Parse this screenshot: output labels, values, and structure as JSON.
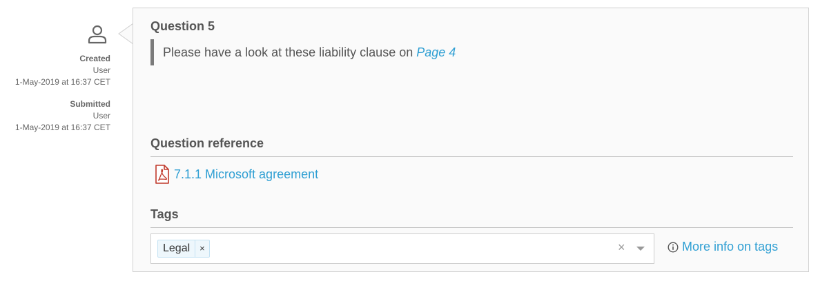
{
  "meta": {
    "created_label": "Created",
    "created_by": "User",
    "created_at": "1-May-2019 at 16:37 CET",
    "submitted_label": "Submitted",
    "submitted_by": "User",
    "submitted_at": "1-May-2019 at 16:37 CET"
  },
  "question": {
    "title": "Question 5",
    "text": "Please have a look at these liability clause on ",
    "link_text": "Page 4"
  },
  "reference": {
    "title": "Question reference",
    "link_text": "7.1.1 Microsoft agreement",
    "icon": "pdf-file-icon"
  },
  "tags": {
    "title": "Tags",
    "items": [
      {
        "label": "Legal",
        "remove_symbol": "×"
      }
    ],
    "clear_symbol": "×",
    "more_info_label": "More info on tags"
  },
  "colors": {
    "link": "#2f9fd3",
    "text": "#555555",
    "quote_bar": "#7a7a7a",
    "pdf_icon": "#c0392b",
    "chip_bg": "#eef7fc"
  }
}
